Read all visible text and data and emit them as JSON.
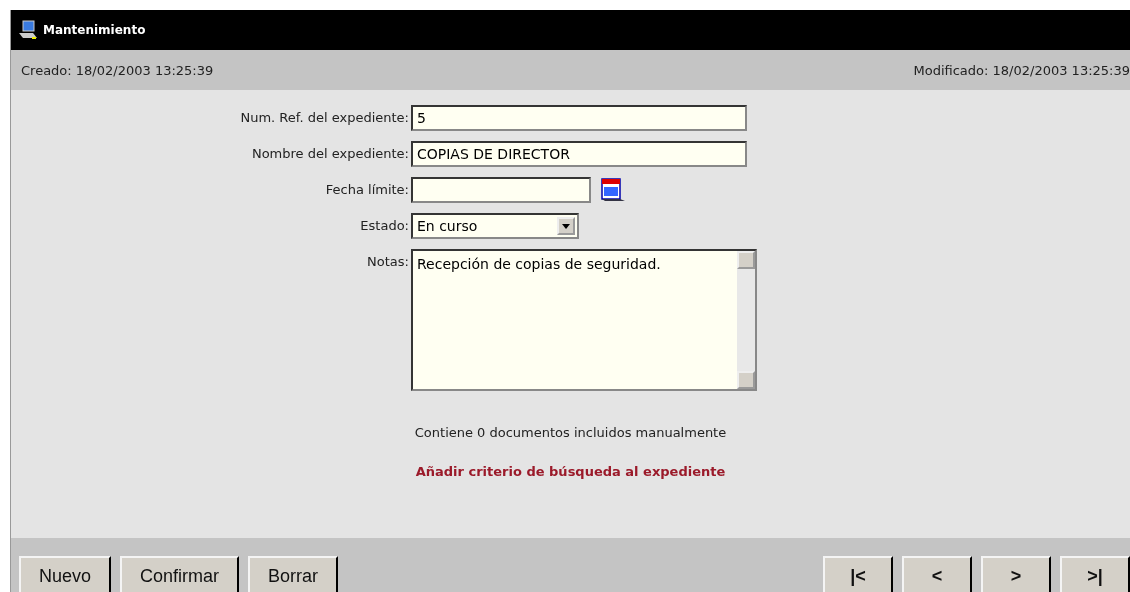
{
  "window": {
    "title": "Mantenimiento"
  },
  "info_bar": {
    "created": "Creado: 18/02/2003 13:25:39",
    "modified": "Modificado: 18/02/2003 13:25:39"
  },
  "form": {
    "fields": [
      {
        "kind": "text",
        "label": "Num. Ref. del expediente:",
        "value": "5"
      },
      {
        "kind": "text",
        "label": "Nombre del expediente:",
        "value": "COPIAS DE DIRECTOR"
      },
      {
        "kind": "date",
        "label": "Fecha límite:"
      },
      {
        "kind": "select",
        "label": "Estado:",
        "value": "En curso"
      },
      {
        "kind": "textarea",
        "label": "Notas:",
        "value": "Recepción de copias de seguridad."
      }
    ]
  },
  "documents_note": "Contiene 0 documentos incluidos manualmente",
  "search_link": "Añadir criterio de búsqueda al expediente",
  "actions": [
    "Nuevo",
    "Confirmar",
    "Borrar"
  ],
  "navigation": [
    "|<",
    "<",
    ">",
    ">|"
  ]
}
